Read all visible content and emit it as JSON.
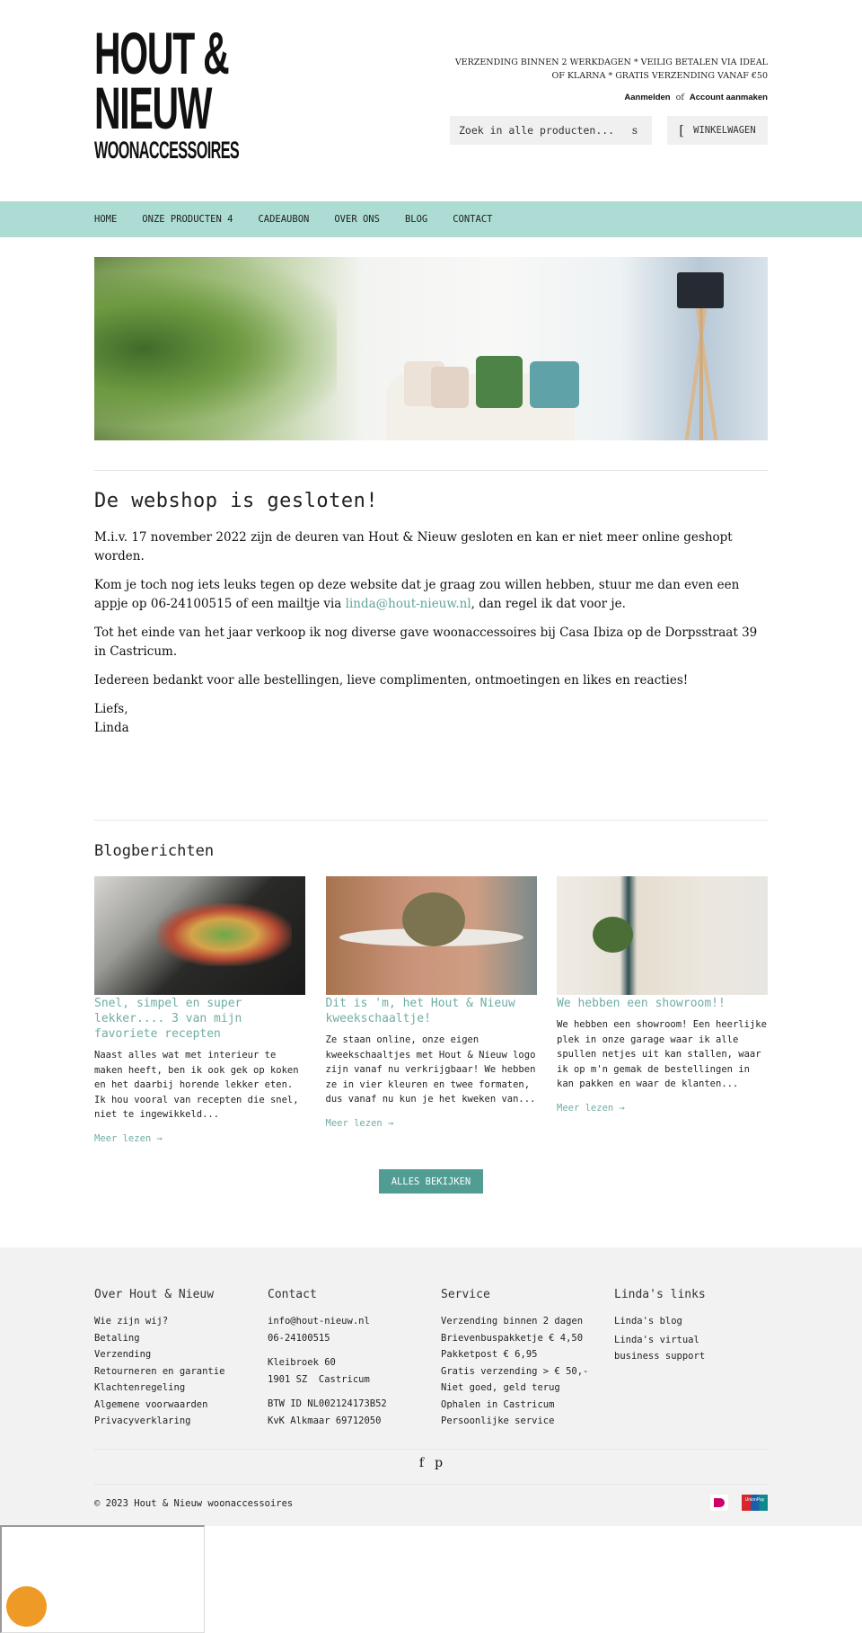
{
  "header": {
    "logo": {
      "line1": "HOUT &",
      "line2": "NIEUW",
      "line3": "WOONACCESSOIRES"
    },
    "usp_text": "VERZENDING BINNEN 2 WERKDAGEN * VEILIG BETALEN VIA IDEAL OF KLARNA * GRATIS VERZENDING VANAF €50",
    "account": {
      "login": "Aanmelden",
      "separator": "of",
      "register": "Account aanmaken"
    },
    "search": {
      "placeholder": "Zoek in alle producten...",
      "icon_glyph": "s",
      "icon": "search-icon"
    },
    "cart": {
      "icon_glyph": "[",
      "icon": "cart-icon",
      "label": "WINKELWAGEN"
    }
  },
  "nav": {
    "items": [
      {
        "label": "HOME"
      },
      {
        "label": "ONZE PRODUCTEN 4"
      },
      {
        "label": "CADEAUBON"
      },
      {
        "label": "OVER ONS"
      },
      {
        "label": "BLOG"
      },
      {
        "label": "CONTACT"
      }
    ],
    "background": "#acdcd4"
  },
  "hero": {
    "alt": "Woonkamer met palm, bank met kussens en vloerlamp"
  },
  "main": {
    "title": "De webshop is gesloten!",
    "p1": "M.i.v. 17 november 2022 zijn de deuren van Hout & Nieuw gesloten en kan er niet meer online geshopt worden.",
    "p2_before": "Kom je toch nog iets leuks tegen op deze website dat je graag zou willen hebben, stuur me dan even een appje op 06-24100515 of een mailtje via ",
    "p2_link": "linda@hout-nieuw.nl",
    "p2_after": ", dan regel ik dat voor je.",
    "p3": "Tot het einde van het jaar verkoop ik nog diverse gave woonaccessoires bij Casa Ibiza op de Dorpsstraat 39 in Castricum.",
    "p4": "Iedereen bedankt voor alle bestellingen, lieve complimenten, ontmoetingen en likes en reacties!",
    "sign_1": "Liefs,",
    "sign_2": "Linda"
  },
  "blog": {
    "title": "Blogberichten",
    "posts": [
      {
        "title": "Snel, simpel en super lekker.... 3 van mijn favoriete recepten",
        "excerpt": "Naast alles wat met interieur te maken heeft, ben ik ook gek op koken en het daarbij horende lekker eten. Ik hou vooral van recepten die snel, niet te ingewikkeld...",
        "more": "Meer lezen →"
      },
      {
        "title": "Dit is 'm, het Hout & Nieuw kweekschaaltje!",
        "excerpt": "Ze staan online, onze eigen kweekschaaltjes met Hout & Nieuw logo zijn vanaf nu verkrijgbaar! We hebben ze in vier kleuren en twee formaten, dus vanaf nu kun je het kweken van...",
        "more": "Meer lezen →"
      },
      {
        "title": "We hebben een showroom!!",
        "excerpt": "We hebben een showroom! Een heerlijke plek in onze garage waar ik alle spullen netjes uit kan stallen, waar ik op m'n gemak de bestellingen in kan pakken en waar de klanten...",
        "more": "Meer lezen →"
      }
    ],
    "all_button": "ALLES BEKIJKEN",
    "accent": "#6fada5",
    "button_color": "#519c93"
  },
  "footer": {
    "columns": [
      {
        "title": "Over Hout & Nieuw",
        "links": [
          "Wie zijn wij?",
          "Betaling",
          "Verzending",
          "Retourneren en garantie",
          "Klachtenregeling",
          "Algemene voorwaarden",
          "Privacyverklaring"
        ]
      },
      {
        "title": "Contact",
        "email": "info@hout-nieuw.nl",
        "phone": "06-24100515",
        "street": "Kleibroek 60",
        "city": "1901 SZ  Castricum",
        "vat": "BTW ID NL002124173B52",
        "kvk": "KvK Alkmaar 69712050"
      },
      {
        "title": "Service",
        "lines": [
          "Verzending binnen 2 dagen",
          "Brievenbuspakketje € 4,50",
          "Pakketpost € 6,95",
          "Gratis verzending > € 50,-",
          "Niet goed, geld terug",
          "Ophalen in Castricum",
          "Persoonlijke service"
        ]
      },
      {
        "title": "Linda's links",
        "links": [
          "Linda's blog",
          "Linda's virtual business support"
        ]
      }
    ],
    "social": [
      {
        "glyph": "f",
        "icon": "facebook-icon"
      },
      {
        "glyph": "p",
        "icon": "pinterest-icon"
      }
    ],
    "copyright": "© 2023 Hout & Nieuw woonaccessoires",
    "payments": [
      {
        "name": "iDEAL",
        "icon": "ideal-icon"
      },
      {
        "name": "UnionPay",
        "icon": "unionpay-icon"
      }
    ]
  },
  "widget": {
    "color": "#ee9a26"
  }
}
